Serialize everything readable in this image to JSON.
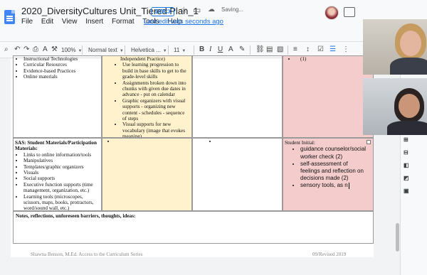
{
  "document": {
    "title": "2020_DiversityCultures Unit_Tiered Plan_1",
    "format_badge": ".DOCX",
    "save_status": "Saving...",
    "last_edit": "Last edit was seconds ago"
  },
  "menu": [
    "File",
    "Edit",
    "View",
    "Insert",
    "Format",
    "Tools",
    "Help"
  ],
  "toolbar": {
    "zoom": "100%",
    "style": "Normal text",
    "font": "Helvetica ...",
    "font_size": "11"
  },
  "table": {
    "row1": {
      "col1_items": [
        "Instructional Technologies",
        "Curricular Resources",
        "Evidence-based Practices",
        "Online materials"
      ],
      "col2_head": "Independent Practice)",
      "col2_items": [
        "Use learning progression to build in base skills to get to the grade-level skills",
        "Assignments broken down into chunks with given due dates in advance - put on calendar",
        "Graphic organizers with visual supports - organizing new content - schedules - sequence of steps",
        "Visual supports for new vocabulary (image that evokes meaning)"
      ],
      "col4_item": "(1)"
    },
    "row2": {
      "col1_title": "SAS: Student Materials/Participation Materials:",
      "col1_items": [
        "Links to online information/tools",
        "Manipulatives",
        "Templates/graphic organizers",
        "Visuals",
        "Social supports",
        "Executive function supports (time management, organization, etc.)",
        "Learning tools (microscopes, scissors, maps, books, protractors, word/sound wall, etc.)"
      ],
      "col4_title": "Student Initial:",
      "col4_items": [
        "guidance counselor/social worker check (2)",
        "self-assessment of feelings and reflection on decisions made (2)",
        "sensory tools, as n"
      ]
    },
    "notes_label": "Notes, reflections, unforeseen barriers, thoughts, ideas:"
  },
  "footer": {
    "left": "Shawna Benson, M.Ed.  Access to the Curriculum Series",
    "right": "09/Revised 2019"
  },
  "colors": {
    "col_yellow": "#fff2cc",
    "col_red": "#f4cccc",
    "link_blue": "#1a73e8"
  }
}
